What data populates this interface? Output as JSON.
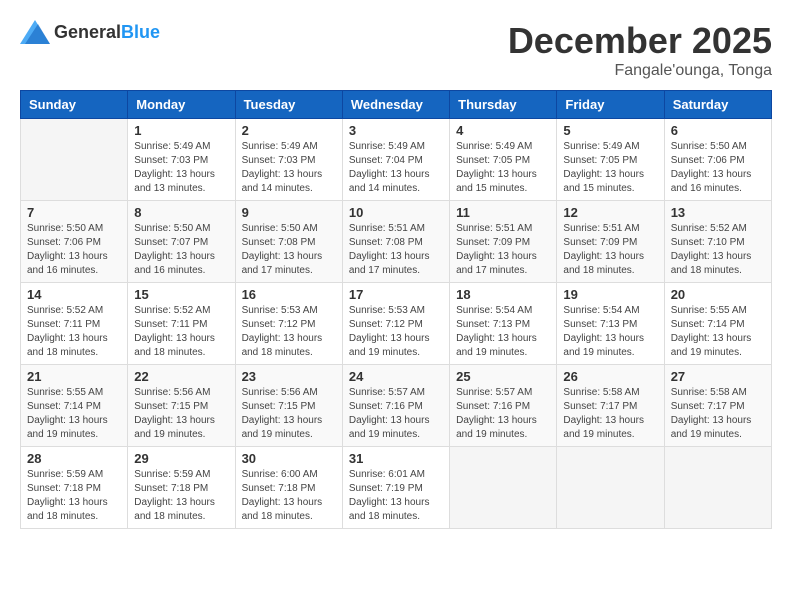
{
  "header": {
    "logo_general": "General",
    "logo_blue": "Blue",
    "month": "December 2025",
    "location": "Fangale'ounga, Tonga"
  },
  "days_of_week": [
    "Sunday",
    "Monday",
    "Tuesday",
    "Wednesday",
    "Thursday",
    "Friday",
    "Saturday"
  ],
  "weeks": [
    [
      {
        "day": "",
        "info": ""
      },
      {
        "day": "1",
        "info": "Sunrise: 5:49 AM\nSunset: 7:03 PM\nDaylight: 13 hours\nand 13 minutes."
      },
      {
        "day": "2",
        "info": "Sunrise: 5:49 AM\nSunset: 7:03 PM\nDaylight: 13 hours\nand 14 minutes."
      },
      {
        "day": "3",
        "info": "Sunrise: 5:49 AM\nSunset: 7:04 PM\nDaylight: 13 hours\nand 14 minutes."
      },
      {
        "day": "4",
        "info": "Sunrise: 5:49 AM\nSunset: 7:05 PM\nDaylight: 13 hours\nand 15 minutes."
      },
      {
        "day": "5",
        "info": "Sunrise: 5:49 AM\nSunset: 7:05 PM\nDaylight: 13 hours\nand 15 minutes."
      },
      {
        "day": "6",
        "info": "Sunrise: 5:50 AM\nSunset: 7:06 PM\nDaylight: 13 hours\nand 16 minutes."
      }
    ],
    [
      {
        "day": "7",
        "info": "Sunrise: 5:50 AM\nSunset: 7:06 PM\nDaylight: 13 hours\nand 16 minutes."
      },
      {
        "day": "8",
        "info": "Sunrise: 5:50 AM\nSunset: 7:07 PM\nDaylight: 13 hours\nand 16 minutes."
      },
      {
        "day": "9",
        "info": "Sunrise: 5:50 AM\nSunset: 7:08 PM\nDaylight: 13 hours\nand 17 minutes."
      },
      {
        "day": "10",
        "info": "Sunrise: 5:51 AM\nSunset: 7:08 PM\nDaylight: 13 hours\nand 17 minutes."
      },
      {
        "day": "11",
        "info": "Sunrise: 5:51 AM\nSunset: 7:09 PM\nDaylight: 13 hours\nand 17 minutes."
      },
      {
        "day": "12",
        "info": "Sunrise: 5:51 AM\nSunset: 7:09 PM\nDaylight: 13 hours\nand 18 minutes."
      },
      {
        "day": "13",
        "info": "Sunrise: 5:52 AM\nSunset: 7:10 PM\nDaylight: 13 hours\nand 18 minutes."
      }
    ],
    [
      {
        "day": "14",
        "info": "Sunrise: 5:52 AM\nSunset: 7:11 PM\nDaylight: 13 hours\nand 18 minutes."
      },
      {
        "day": "15",
        "info": "Sunrise: 5:52 AM\nSunset: 7:11 PM\nDaylight: 13 hours\nand 18 minutes."
      },
      {
        "day": "16",
        "info": "Sunrise: 5:53 AM\nSunset: 7:12 PM\nDaylight: 13 hours\nand 18 minutes."
      },
      {
        "day": "17",
        "info": "Sunrise: 5:53 AM\nSunset: 7:12 PM\nDaylight: 13 hours\nand 19 minutes."
      },
      {
        "day": "18",
        "info": "Sunrise: 5:54 AM\nSunset: 7:13 PM\nDaylight: 13 hours\nand 19 minutes."
      },
      {
        "day": "19",
        "info": "Sunrise: 5:54 AM\nSunset: 7:13 PM\nDaylight: 13 hours\nand 19 minutes."
      },
      {
        "day": "20",
        "info": "Sunrise: 5:55 AM\nSunset: 7:14 PM\nDaylight: 13 hours\nand 19 minutes."
      }
    ],
    [
      {
        "day": "21",
        "info": "Sunrise: 5:55 AM\nSunset: 7:14 PM\nDaylight: 13 hours\nand 19 minutes."
      },
      {
        "day": "22",
        "info": "Sunrise: 5:56 AM\nSunset: 7:15 PM\nDaylight: 13 hours\nand 19 minutes."
      },
      {
        "day": "23",
        "info": "Sunrise: 5:56 AM\nSunset: 7:15 PM\nDaylight: 13 hours\nand 19 minutes."
      },
      {
        "day": "24",
        "info": "Sunrise: 5:57 AM\nSunset: 7:16 PM\nDaylight: 13 hours\nand 19 minutes."
      },
      {
        "day": "25",
        "info": "Sunrise: 5:57 AM\nSunset: 7:16 PM\nDaylight: 13 hours\nand 19 minutes."
      },
      {
        "day": "26",
        "info": "Sunrise: 5:58 AM\nSunset: 7:17 PM\nDaylight: 13 hours\nand 19 minutes."
      },
      {
        "day": "27",
        "info": "Sunrise: 5:58 AM\nSunset: 7:17 PM\nDaylight: 13 hours\nand 19 minutes."
      }
    ],
    [
      {
        "day": "28",
        "info": "Sunrise: 5:59 AM\nSunset: 7:18 PM\nDaylight: 13 hours\nand 18 minutes."
      },
      {
        "day": "29",
        "info": "Sunrise: 5:59 AM\nSunset: 7:18 PM\nDaylight: 13 hours\nand 18 minutes."
      },
      {
        "day": "30",
        "info": "Sunrise: 6:00 AM\nSunset: 7:18 PM\nDaylight: 13 hours\nand 18 minutes."
      },
      {
        "day": "31",
        "info": "Sunrise: 6:01 AM\nSunset: 7:19 PM\nDaylight: 13 hours\nand 18 minutes."
      },
      {
        "day": "",
        "info": ""
      },
      {
        "day": "",
        "info": ""
      },
      {
        "day": "",
        "info": ""
      }
    ]
  ]
}
